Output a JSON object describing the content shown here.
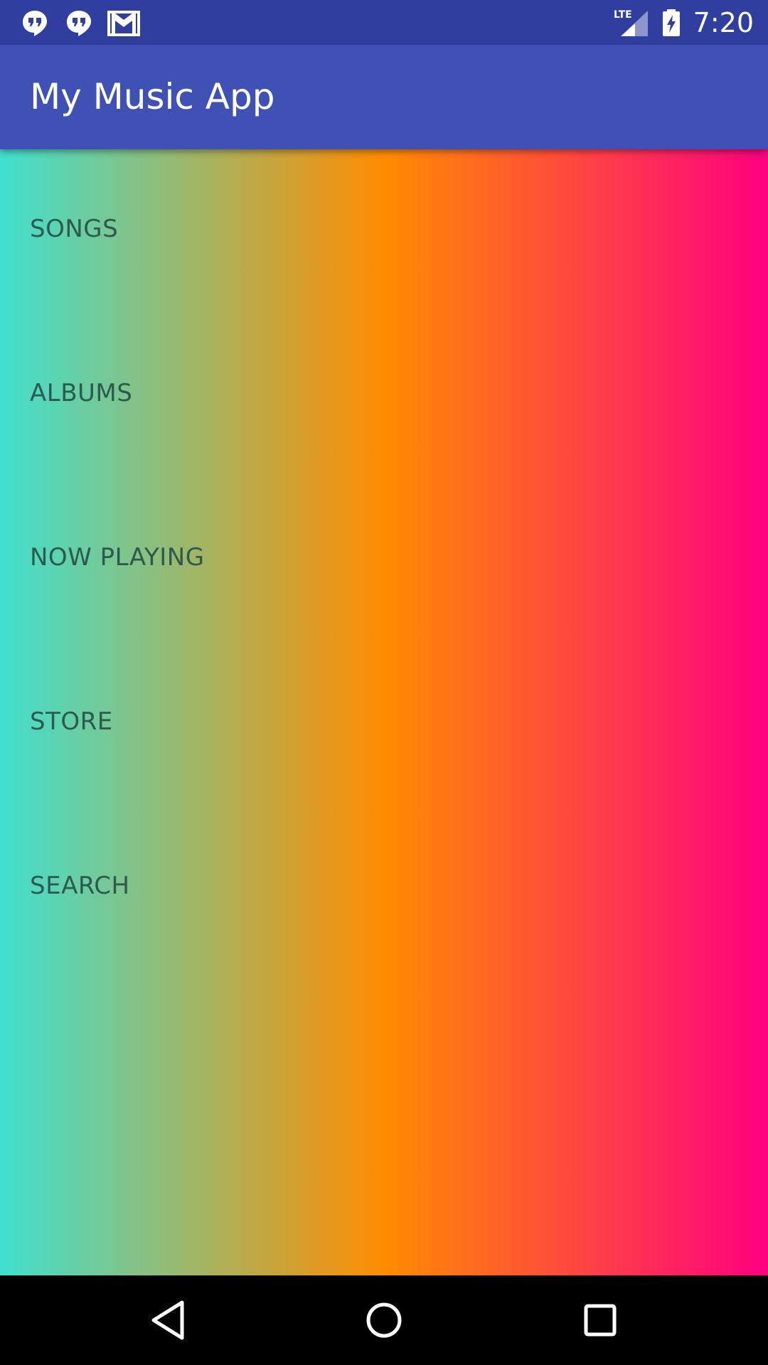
{
  "status_bar": {
    "time": "7:20",
    "network": "LTE",
    "notification_icons": [
      "hangouts-icon",
      "hangouts-icon",
      "gmail-icon"
    ]
  },
  "app_bar": {
    "title": "My Music App"
  },
  "menu": {
    "items": [
      {
        "label": "SONGS"
      },
      {
        "label": "ALBUMS"
      },
      {
        "label": "NOW PLAYING"
      },
      {
        "label": "STORE"
      },
      {
        "label": "SEARCH"
      }
    ]
  },
  "colors": {
    "status_bar": "#303f9f",
    "app_bar": "#3f51b5",
    "gradient": [
      "#40e0d0",
      "#ff8c00",
      "#ff0080"
    ],
    "menu_text": "#2d5a4c"
  },
  "nav_bar": {
    "icons": [
      "back-icon",
      "home-icon",
      "recents-icon"
    ]
  }
}
